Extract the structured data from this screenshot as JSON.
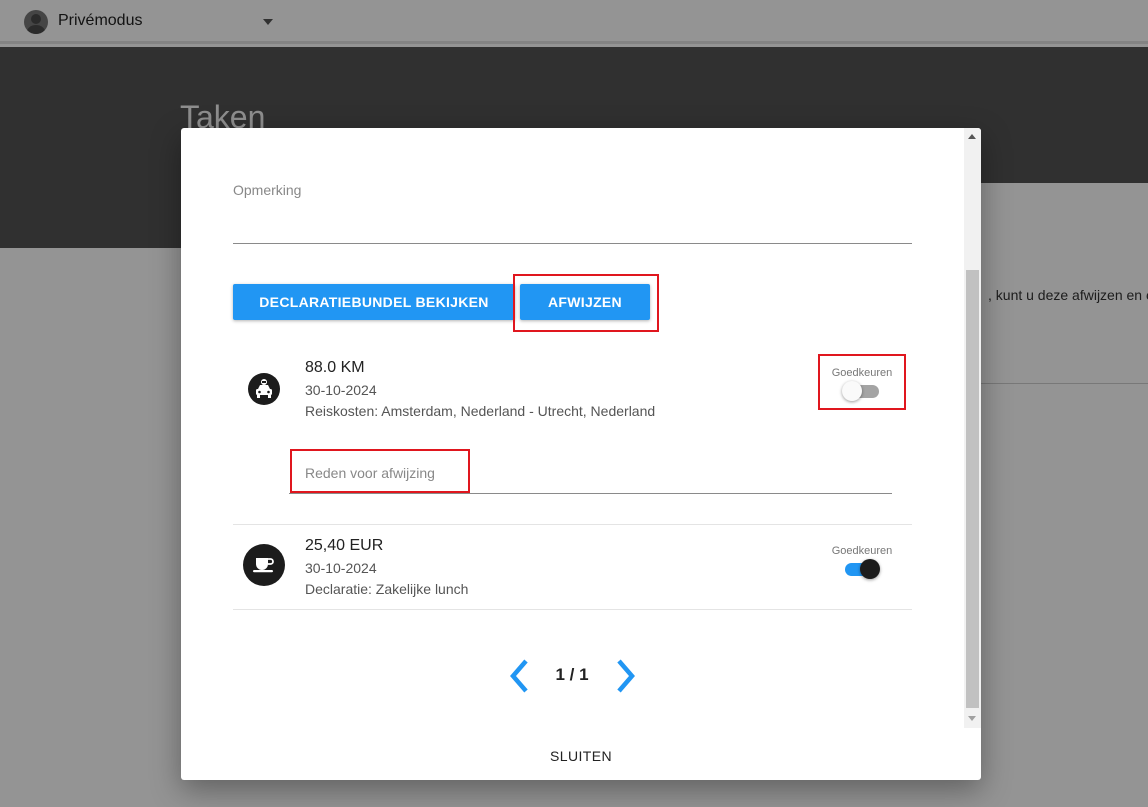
{
  "topbar": {
    "mode_label": "Privémodus",
    "avatar_icon": "user-avatar-icon",
    "caret_icon": "caret-down-icon"
  },
  "page": {
    "title": "Taken",
    "visible_text": ", kunt u deze afwijzen en e"
  },
  "modal": {
    "remark_label": "Opmerking",
    "buttons": {
      "bundle": "DECLARATIEBUNDEL BEKIJKEN",
      "reject": "AFWIJZEN"
    },
    "items": [
      {
        "icon": "taxi-icon",
        "title": "88.0 KM",
        "date": "30-10-2024",
        "description": "Reiskosten: Amsterdam, Nederland - Utrecht, Nederland",
        "approve_label": "Goedkeuren",
        "approved": false,
        "reason_placeholder": "Reden voor afwijzing"
      },
      {
        "icon": "coffee-cup-icon",
        "title": "25,40 EUR",
        "date": "30-10-2024",
        "description": "Declaratie: Zakelijke lunch",
        "approve_label": "Goedkeuren",
        "approved": true
      }
    ],
    "pager": {
      "text": "1 / 1",
      "prev_icon": "chevron-left-icon",
      "next_icon": "chevron-right-icon"
    },
    "close_label": "SLUITEN"
  },
  "colors": {
    "primary": "#2196f3",
    "highlight": "#e0161e",
    "icon_bg": "#1c1c1c"
  }
}
